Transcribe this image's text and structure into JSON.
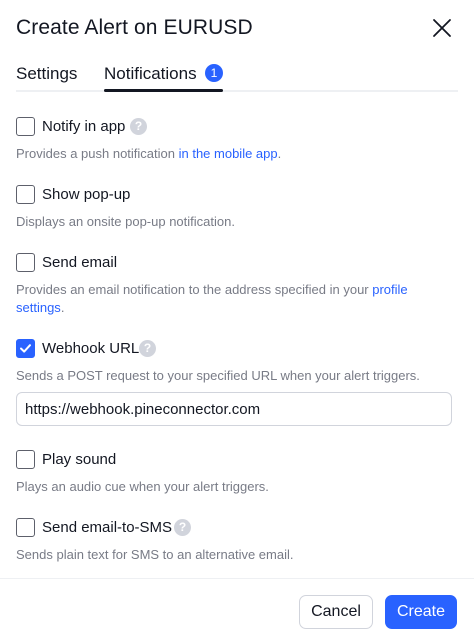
{
  "dialog": {
    "title": "Create Alert on EURUSD"
  },
  "tabs": [
    {
      "label": "Settings",
      "active": false
    },
    {
      "label": "Notifications",
      "active": true,
      "badge": "1"
    }
  ],
  "options": [
    {
      "label": "Notify in app",
      "checked": false,
      "help": "?",
      "desc_prefix": "Provides a push notification ",
      "desc_link": "in the mobile app",
      "desc_suffix": "."
    },
    {
      "label": "Show pop-up",
      "checked": false,
      "desc": "Displays an onsite pop-up notification."
    },
    {
      "label": "Send email",
      "checked": false,
      "desc_prefix": "Provides an email notification to the address specified in your ",
      "desc_link": "profile settings",
      "desc_suffix": "."
    },
    {
      "label": "Webhook URL",
      "checked": true,
      "help": "?",
      "desc": "Sends a POST request to your specified URL when your alert triggers.",
      "input_value": "https://webhook.pineconnector.com"
    },
    {
      "label": "Play sound",
      "checked": false,
      "desc": "Plays an audio cue when your alert triggers."
    },
    {
      "label": "Send email-to-SMS",
      "checked": false,
      "help": "?",
      "desc": "Sends plain text for SMS to an alternative email."
    }
  ],
  "footer": {
    "cancel_label": "Cancel",
    "create_label": "Create"
  },
  "colors": {
    "accent": "#2962ff",
    "text": "#131722",
    "muted": "#787b86"
  }
}
